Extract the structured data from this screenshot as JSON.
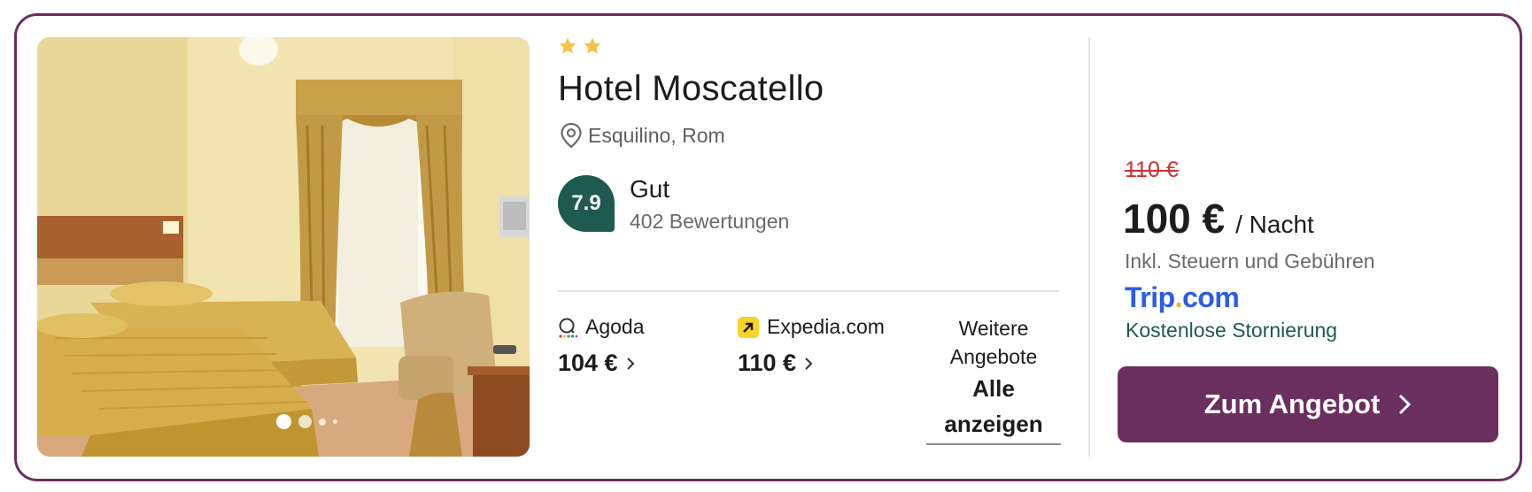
{
  "hotel": {
    "star_count": 2,
    "name": "Hotel Moscatello",
    "location": "Esquilino, Rom",
    "score": "7.9",
    "rating_label": "Gut",
    "review_count": "402 Bewertungen"
  },
  "gallery": {
    "image_count_dots": 4,
    "active_index": 0
  },
  "offers": [
    {
      "provider": "Agoda",
      "price": "104 €",
      "icon": "agoda-icon"
    },
    {
      "provider": "Expedia.com",
      "price": "110 €",
      "icon": "expedia-icon"
    }
  ],
  "more_offers": {
    "label_line1": "Weitere",
    "label_line2": "Angebote",
    "link_line1": "Alle",
    "link_line2": "anzeigen"
  },
  "best_offer": {
    "old_price": "110 €",
    "price": "100 €",
    "price_unit": "/ Nacht",
    "tax_note": "Inkl. Steuern und Gebühren",
    "provider_name_main": "Trip",
    "provider_name_dot": ".",
    "provider_name_tld": "com",
    "cancellation": "Kostenlose Stornierung",
    "cta_label": "Zum Angebot"
  },
  "colors": {
    "accent": "#6b2f5f",
    "score_badge": "#1f5a50",
    "old_price": "#d32f2f",
    "provider_logo": "#2b5be8",
    "star": "#f6c24a"
  }
}
